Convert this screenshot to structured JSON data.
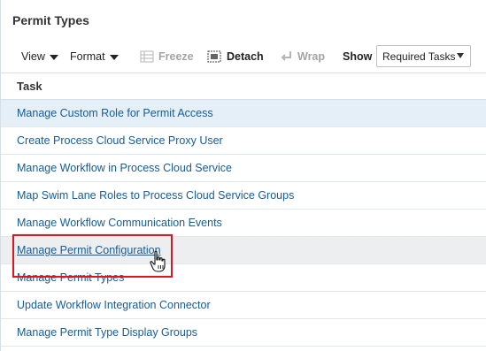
{
  "panel": {
    "title": "Permit Types"
  },
  "toolbar": {
    "view_label": "View",
    "format_label": "Format",
    "freeze_label": "Freeze",
    "detach_label": "Detach",
    "wrap_label": "Wrap",
    "show_label": "Show",
    "show_select_value": "Required Tasks"
  },
  "table": {
    "column_header": "Task",
    "rows": [
      "Manage Custom Role for Permit Access",
      "Create Process Cloud Service Proxy User",
      "Manage Workflow in Process Cloud Service",
      "Map Swim Lane Roles to Process Cloud Service Groups",
      "Manage Workflow Communication Events",
      "Manage Permit Configuration",
      "Manage Permit Types",
      "Update Workflow Integration Connector",
      "Manage Permit Type Display Groups"
    ]
  },
  "colors": {
    "link": "#145c9e",
    "selected_row": "#e4eff8",
    "hover_row": "#edeef0",
    "highlight": "#e0141f"
  }
}
